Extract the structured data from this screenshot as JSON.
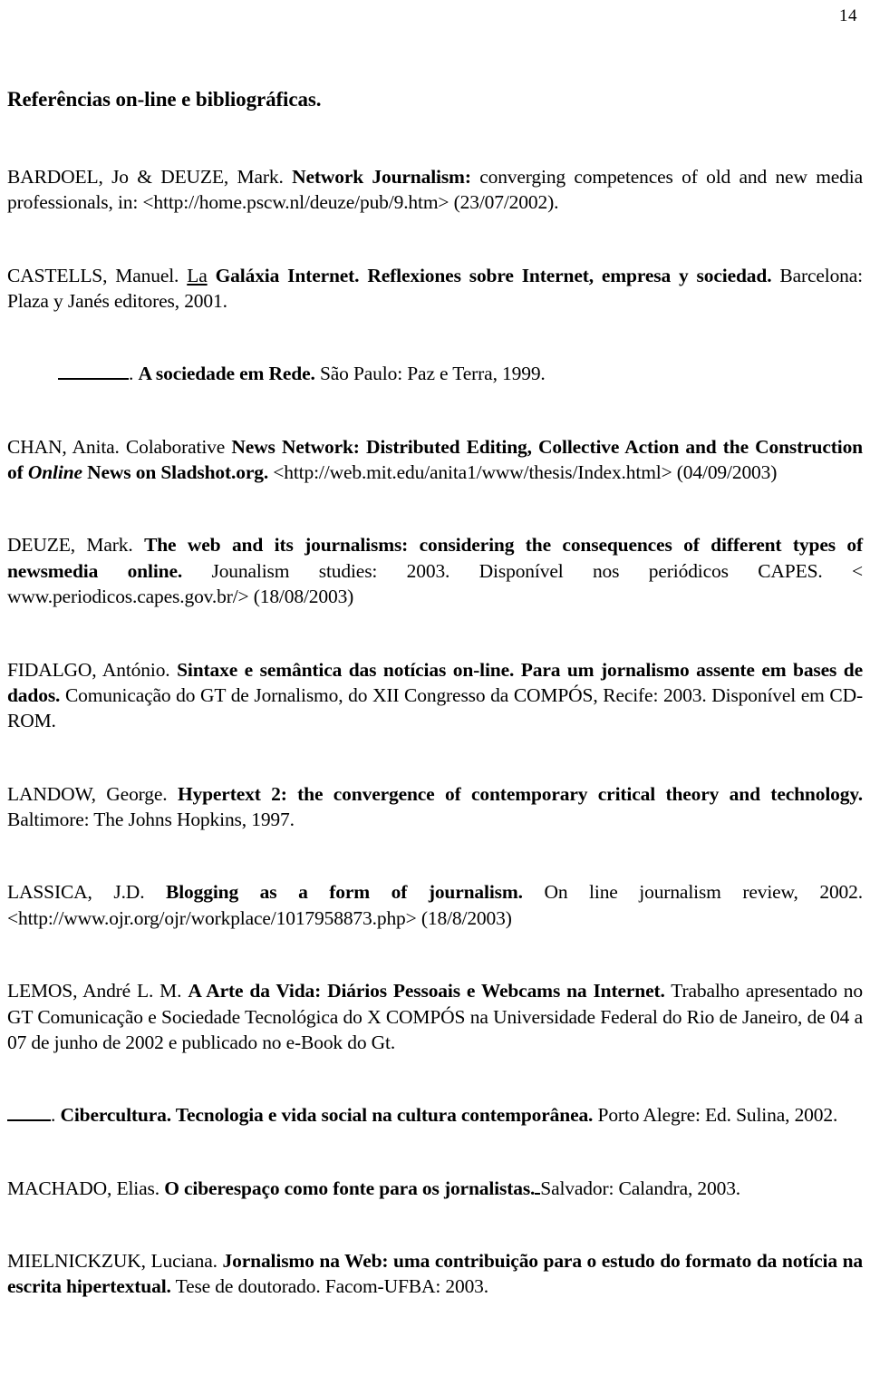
{
  "page": {
    "number": "14",
    "section_title": "Referências on-line e bibliográficas."
  },
  "references": [
    {
      "id": "bardoel",
      "author": "BARDOEL, Jo & DEUZE, Mark.",
      "title_bold": "Network Journalism:",
      "rest": " converging competences of old and new media professionals, in: <http://home.pscw.nl/deuze/pub/9.htm> (23/07/2002)."
    },
    {
      "id": "castells-galaxia",
      "author": "CASTELLS, Manuel.",
      "underlined_word": "La",
      "title_bold": "Galáxia Internet. Reflexiones sobre Internet, empresa y sociedad.",
      "rest": " Barcelona: Plaza y Janés editores, 2001."
    },
    {
      "id": "castells-sociedade",
      "dash_lead": true,
      "separator": ".",
      "title_bold": "A sociedade em Rede.",
      "rest": " São Paulo: Paz e Terra, 1999."
    },
    {
      "id": "chan",
      "author": "CHAN, Anita. Colaborative",
      "title_bold_a": "News Network: Distributed Editing, Collective Action and the Construction of",
      "title_bold_italic": "Online",
      "title_bold_b": "News on Sladshot.org.",
      "rest": " <http://web.mit.edu/anita1/www/thesis/Index.html> (04/09/2003)"
    },
    {
      "id": "deuze",
      "author": "DEUZE, Mark.",
      "title_bold": "The web and its journalisms: considering the consequences of different types of newsmedia online.",
      "rest": " Jounalism studies: 2003. Disponível nos periódicos CAPES. < www.periodicos.capes.gov.br/> (18/08/2003)"
    },
    {
      "id": "fidalgo",
      "author": "FIDALGO, António.",
      "title_bold": "Sintaxe e semântica das notícias on-line. Para um jornalismo assente em bases de dados.",
      "rest": " Comunicação do GT de Jornalismo, do XII Congresso da COMPÓS, Recife: 2003. Disponível em CD-ROM."
    },
    {
      "id": "landow",
      "author": "LANDOW, George.",
      "title_bold": "Hypertext 2: the convergence of contemporary critical theory and technology.",
      "rest": " Baltimore: The Johns Hopkins, 1997."
    },
    {
      "id": "lassica",
      "author": "LASSICA, J.D.",
      "title_bold": "Blogging as a form of journalism.",
      "rest": " On line journalism review, 2002. <http://www.ojr.org/ojr/workplace/1017958873.php> (18/8/2003)"
    },
    {
      "id": "lemos-arte",
      "author": "LEMOS, André L. M.",
      "title_bold": "A Arte da Vida: Diários Pessoais e Webcams na Internet.",
      "rest": " Trabalho apresentado no GT Comunicação e Sociedade Tecnológica do X COMPÓS na Universidade Federal do Rio de Janeiro, de 04 a 07 de junho de 2002 e publicado no e-Book do Gt."
    },
    {
      "id": "lemos-cibercultura",
      "dash_lead": true,
      "separator": ".",
      "title_bold": "Cibercultura. Tecnologia e vida social na cultura contemporânea.",
      "rest": " Porto Alegre: Ed. Sulina, 2002."
    },
    {
      "id": "machado",
      "author": "MACHADO, Elias.",
      "title_bold": "O ciberespaço como fonte para os jornalistas.",
      "rest": "Salvador: Calandra, 2003."
    },
    {
      "id": "mielnickzuk",
      "author": "MIELNICKZUK, Luciana.",
      "title_bold": "Jornalismo na Web: uma contribuição para o estudo do formato da notícia na escrita hipertextual.",
      "rest": " Tese de doutorado. Facom-UFBA: 2003."
    }
  ]
}
